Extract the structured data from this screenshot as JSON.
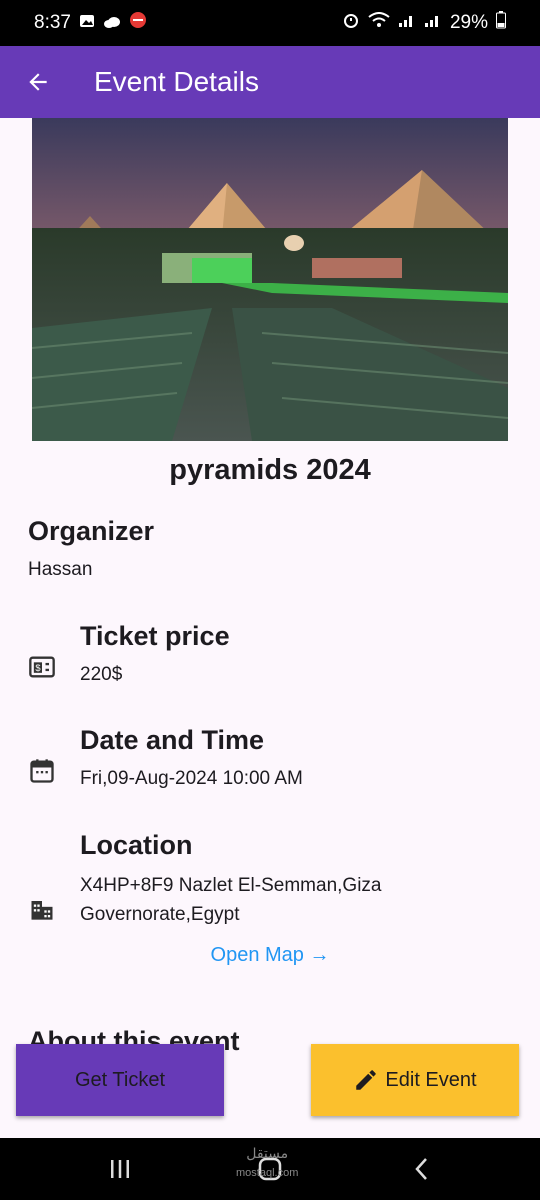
{
  "status_bar": {
    "time": "8:37",
    "battery": "29%"
  },
  "app_bar": {
    "title": "Event Details"
  },
  "event": {
    "title": "pyramids 2024",
    "organizer_label": "Organizer",
    "organizer": "Hassan",
    "price_label": "Ticket price",
    "price": "220$",
    "date_label": "Date and Time",
    "date": "Fri,09-Aug-2024 10:00 AM",
    "location_label": "Location",
    "location": "X4HP+8F9 Nazlet El-Semman,Giza Governorate,Egypt",
    "open_map": "Open Map →",
    "about_label": "About this event"
  },
  "actions": {
    "get_ticket": "Get Ticket",
    "edit_event": "Edit Event"
  },
  "watermark": {
    "arabic": "مستقل",
    "latin": "mostaql.com"
  },
  "colors": {
    "primary": "#673ab7",
    "accent": "#fbc02d",
    "link": "#2196f3",
    "background": "#fdf7fd"
  }
}
